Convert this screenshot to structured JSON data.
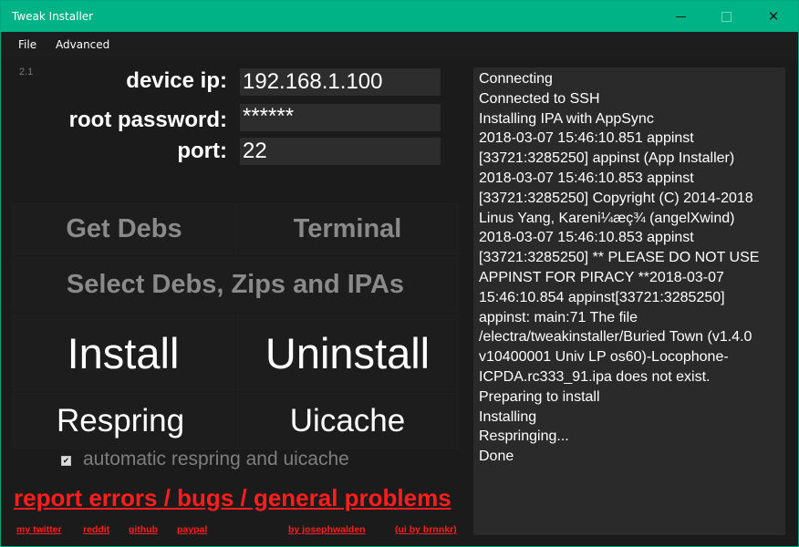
{
  "window": {
    "title": "Tweak Installer",
    "close_glyph": "✕"
  },
  "menu": {
    "items": [
      "File",
      "Advanced"
    ]
  },
  "version": "2.1",
  "connection": {
    "ip_label": "device ip:",
    "ip_value": "192.168.1.100",
    "password_label": "root password:",
    "password_value": "******",
    "port_label": "port:",
    "port_value": "22"
  },
  "buttons": {
    "get_debs": "Get Debs",
    "terminal": "Terminal",
    "select_debs": "Select Debs, Zips and IPAs",
    "install": "Install",
    "uninstall": "Uninstall",
    "respring": "Respring",
    "uicache": "Uicache"
  },
  "options": {
    "auto_respring_label": "automatic respring and uicache",
    "auto_respring_checked": true,
    "check_glyph": "✔"
  },
  "links": {
    "report": "report errors / bugs / general problems",
    "twitter": "my twitter",
    "reddit": "reddit",
    "github": "github",
    "paypal": "paypal",
    "author": "by josephwalden",
    "ui_credit": "(ui by brnnkr)"
  },
  "log": {
    "lines": [
      "Connecting",
      "Connected to SSH",
      "Installing IPA with AppSync",
      "2018-03-07 15:46:10.851 appinst",
      "[33721:3285250] appinst (App Installer)",
      "2018-03-07 15:46:10.853 appinst",
      "[33721:3285250] Copyright (C) 2014-2018",
      "Linus Yang, Kareni¼æç¾ (angelXwind)",
      "2018-03-07 15:46:10.853 appinst",
      "[33721:3285250] ** PLEASE DO NOT USE",
      "APPINST FOR PIRACY **2018-03-07",
      "15:46:10.854 appinst[33721:3285250]",
      "appinst: main:71 The file",
      "/electra/tweakinstaller/Buried Town (v1.4.0",
      "v10400001 Univ LP os60)-Locophone-",
      "ICPDA.rc333_91.ipa does not exist.",
      "Preparing to install",
      "Installing",
      "Respringing...",
      "Done"
    ]
  },
  "colors": {
    "titlebar": "#00b386",
    "link_red": "#ff1d1d",
    "background": "#1b1b1b"
  }
}
